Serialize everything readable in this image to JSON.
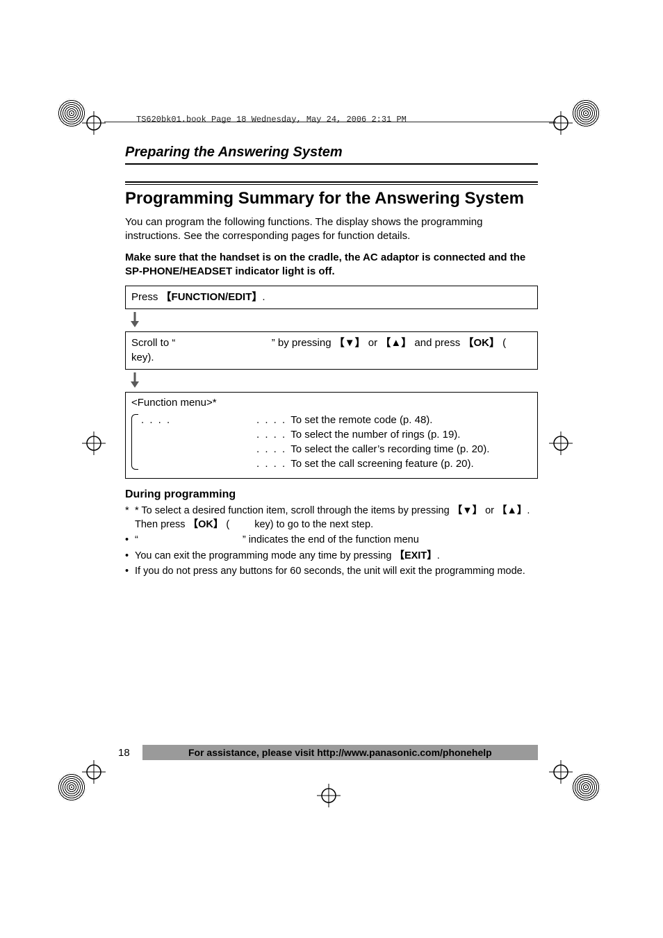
{
  "stamp": "TS620bk01.book  Page 18  Wednesday, May 24, 2006  2:31 PM",
  "section_title": "Preparing the Answering System",
  "h1": "Programming Summary for the Answering System",
  "intro": "You can program the following functions. The display shows the programming instructions. See the corresponding pages for function details.",
  "warning": "Make sure that the handset is on the cradle, the AC adaptor is connected and the SP-PHONE/HEADSET indicator light is off.",
  "step1_pre": "Press ",
  "step1_key": "FUNCTION/EDIT",
  "step1_post": ".",
  "step2_pre": "Scroll to “",
  "step2_mid": "” by pressing ",
  "step2_down": "▼",
  "step2_or": " or ",
  "step2_up": "▲",
  "step2_andpress": " and press ",
  "step2_ok": "OK",
  "step2_paren_open": " (",
  "step2_keyword": " key).",
  "menu_header": "<Function menu>*",
  "menu_items": [
    {
      "desc": "To set the remote code (p. 48)."
    },
    {
      "desc": "To select the number of rings (p. 19)."
    },
    {
      "desc": "To select the caller’s recording time (p. 20)."
    },
    {
      "desc": "To set the call screening feature (p. 20)."
    }
  ],
  "sub_h": "During programming",
  "note_star_a": "* To select a desired function item, scroll through the items by pressing ",
  "note_star_b": ". Then press ",
  "note_star_c": " (",
  "note_star_d": " key) to go to the next step.",
  "note_end_a": "“",
  "note_end_b": "” indicates the end of the function menu",
  "note_exit_a": "You can exit the programming mode any time by pressing ",
  "note_exit_key": "EXIT",
  "note_exit_b": ".",
  "note60": "If you do not press any buttons for 60 seconds, the unit will exit the programming mode.",
  "page_number": "18",
  "assist_bar": "For assistance, please visit http://www.panasonic.com/phonehelp"
}
